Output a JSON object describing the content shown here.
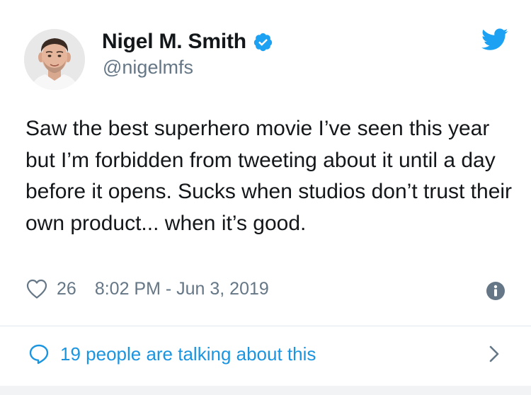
{
  "author": {
    "display_name": "Nigel M. Smith",
    "handle": "@nigelmfs",
    "verified": true,
    "avatar_icon": "profile-photo"
  },
  "tweet": {
    "text": "Saw the best superhero movie I’ve seen this year but I’m forbidden from tweeting about it until a day before it opens. Sucks when studios don’t trust their own product... when it’s good.",
    "like_count": "26",
    "timestamp": "8:02 PM - Jun 3, 2019"
  },
  "footer": {
    "talking_label": "19 people are talking about this"
  },
  "icons": {
    "brand": "twitter-bird-icon",
    "verified": "verified-badge-icon",
    "like": "heart-icon",
    "info": "info-icon",
    "talk": "speech-bubble-icon",
    "more": "chevron-right-icon"
  },
  "colors": {
    "brand_blue": "#1da1f2",
    "link_blue": "#1b95e0",
    "text_primary": "#14171a",
    "text_secondary": "#657786"
  }
}
